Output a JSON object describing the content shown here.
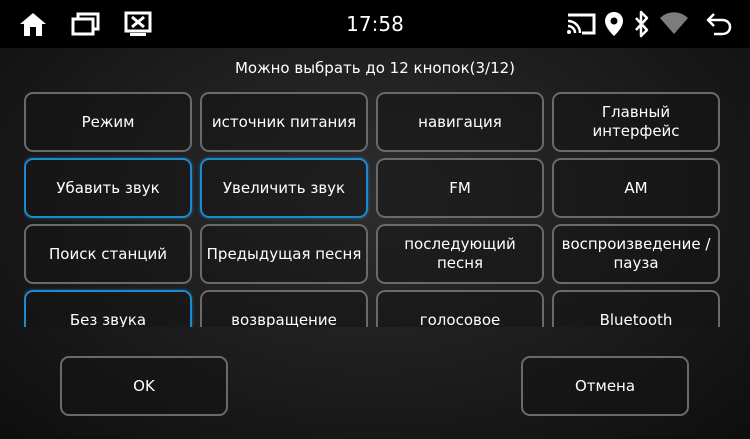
{
  "status_bar": {
    "time": "17:58",
    "left_icons": [
      "home-icon",
      "recent-apps-icon",
      "screen-off-icon"
    ],
    "right_icons": [
      "cast-icon",
      "location-pin-icon",
      "bluetooth-icon",
      "wifi-icon",
      "back-icon"
    ]
  },
  "dialog": {
    "subtitle": "Можно выбрать до 12 кнопок(3/12)",
    "buttons": [
      {
        "label": "Режим",
        "selected": false
      },
      {
        "label": "источник питания",
        "selected": false
      },
      {
        "label": "навигация",
        "selected": false
      },
      {
        "label": "Главный интерфейс",
        "selected": false
      },
      {
        "label": "Убавить звук",
        "selected": true
      },
      {
        "label": "Увеличить звук",
        "selected": true
      },
      {
        "label": "FM",
        "selected": false
      },
      {
        "label": "AM",
        "selected": false
      },
      {
        "label": "Поиск станций",
        "selected": false
      },
      {
        "label": "Предыдущая песня",
        "selected": false
      },
      {
        "label": "последующий песня",
        "selected": false
      },
      {
        "label": "воспроизведение / пауза",
        "selected": false
      },
      {
        "label": "Без звука",
        "selected": true
      },
      {
        "label": "возвращение",
        "selected": false
      },
      {
        "label": "голосовое",
        "selected": false
      },
      {
        "label": "Bluetooth",
        "selected": false
      }
    ],
    "ok_label": "OK",
    "cancel_label": "Отмена"
  },
  "colors": {
    "selected_border": "#1e88d0",
    "default_border": "#6a6a6a",
    "status_bar_bg": "#000000"
  }
}
